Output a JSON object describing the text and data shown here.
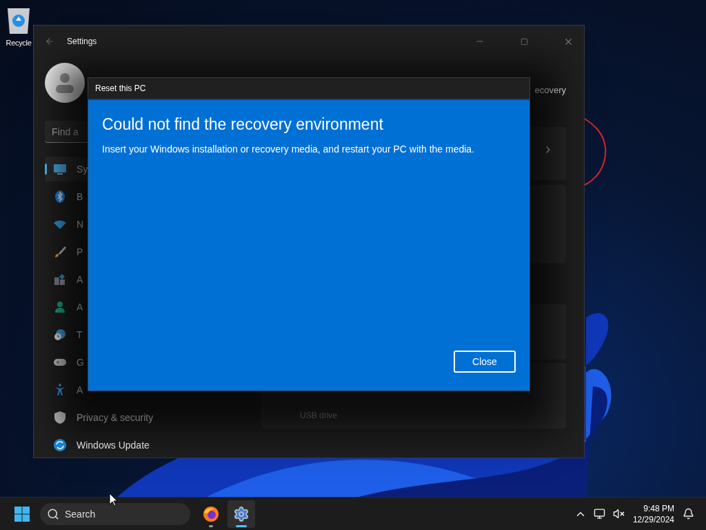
{
  "desktop": {
    "icons": [
      {
        "kind": "recycle",
        "label": "Recycle"
      }
    ]
  },
  "settings_window": {
    "title": "Settings",
    "search": {
      "placeholder": "Find a"
    },
    "nav_items": [
      {
        "kind": "system",
        "label": "Sy",
        "selected": true
      },
      {
        "kind": "bluetooth",
        "label": "B",
        "selected": false
      },
      {
        "kind": "network",
        "label": "N",
        "selected": false
      },
      {
        "kind": "personalization",
        "label": "P",
        "selected": false
      },
      {
        "kind": "apps",
        "label": "A",
        "selected": false
      },
      {
        "kind": "accounts",
        "label": "A",
        "selected": false
      },
      {
        "kind": "time",
        "label": "T",
        "selected": false
      },
      {
        "kind": "gaming",
        "label": "G",
        "selected": false
      },
      {
        "kind": "accessibility",
        "label": "A",
        "selected": false
      },
      {
        "kind": "privacy",
        "label": "Privacy & security",
        "selected": false
      },
      {
        "kind": "update",
        "label": "Windows Update",
        "selected": false
      }
    ],
    "breadcrumb": "ecovery",
    "cards": [
      {
        "kind": "link"
      },
      {
        "kind": "plain"
      },
      {
        "kind": "plain"
      },
      {
        "kind": "text",
        "text": "USB drive"
      }
    ]
  },
  "dialog": {
    "title": "Reset this PC",
    "heading": "Could not find the recovery environment",
    "message": "Insert your Windows installation or recovery media, and restart your PC with the media.",
    "buttons": [
      "Close"
    ]
  },
  "taskbar": {
    "search": {
      "placeholder": "Search"
    },
    "apps": [
      {
        "kind": "firefox",
        "active": false
      },
      {
        "kind": "settings",
        "active": true
      }
    ],
    "time": "9:48 PM",
    "date": "12/29/2024"
  }
}
